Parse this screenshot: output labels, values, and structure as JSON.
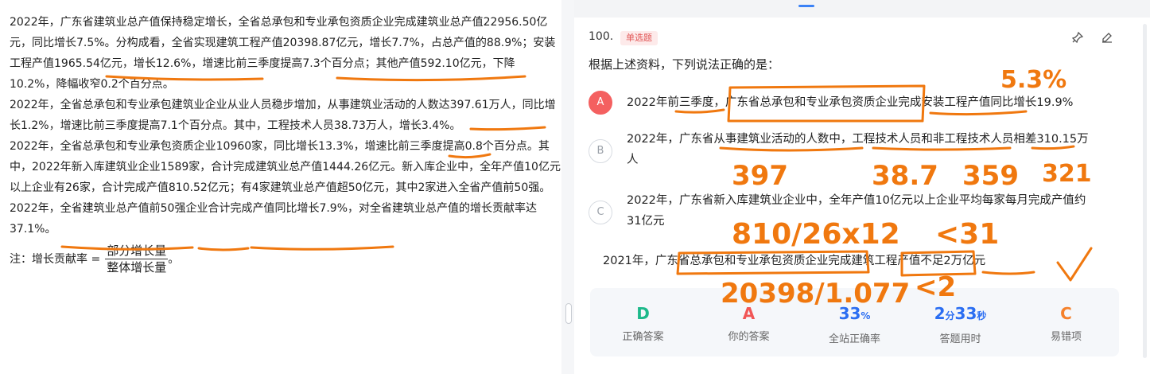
{
  "passage": {
    "p1": "2022年，广东省建筑业总产值保持稳定增长，全省总承包和专业承包资质企业完成建筑业总产值22956.50亿元，同比增长7.5%。分构成看，全省实现建筑工程产值20398.87亿元，增长7.7%，占总产值的88.9%；安装工程产值1965.54亿元，增长12.6%，增速比前三季度提高7.3个百分点；其他产值592.10亿元，下降10.2%，降幅收窄0.2个百分点。",
    "p2": "2022年，全省总承包和专业承包建筑业企业从业人员稳步增加，从事建筑业活动的人数达397.61万人，同比增长1.2%，增速比前三季度提高7.1个百分点。其中，工程技术人员38.73万人，增长3.4%。",
    "p3": "2022年，全省总承包和专业承包资质企业10960家，同比增长13.3%，增速比前三季度提高0.8个百分点。其中，2022年新入库建筑业企业1589家，合计完成建筑业总产值1444.26亿元。新入库企业中，全年产值10亿元以上企业有26家，合计完成产值810.52亿元；有4家建筑业总产值超50亿元，其中2家进入全省产值前50强。2022年，全省建筑业总产值前50强企业合计完成产值同比增长7.9%，对全省建筑业总产值的增长贡献率达37.1%。",
    "note_prefix": "注：增长贡献率 =",
    "note_numerator": "部分增长量",
    "note_denominator": "整体增长量",
    "note_suffix": "。"
  },
  "question": {
    "number": "100.",
    "type_badge": "单选题",
    "stem": "根据上述资料，下列说法正确的是：",
    "options": [
      {
        "letter": "A",
        "text": "2022年前三季度，广东省总承包和专业承包资质企业完成安装工程产值同比增长19.9%",
        "state": "wrong"
      },
      {
        "letter": "B",
        "text": "2022年，广东省从事建筑业活动的人数中，工程技术人员和非工程技术人员相差310.15万人",
        "state": "normal"
      },
      {
        "letter": "C",
        "text": "2022年，广东省新入库建筑业企业中，全年产值10亿元以上企业平均每家每月完成产值约31亿元",
        "state": "normal"
      },
      {
        "letter": "D",
        "text": "2021年，广东省总承包和专业承包资质企业完成建筑工程产值不足2万亿元",
        "state": "right"
      }
    ]
  },
  "stats": [
    {
      "value": "D",
      "unit": "",
      "label": "正确答案",
      "color": "#1db98a"
    },
    {
      "value": "A",
      "unit": "",
      "label": "你的答案",
      "color": "#f15656"
    },
    {
      "value": "33",
      "unit": "%",
      "label": "全站正确率",
      "color": "#2b6ef2"
    },
    {
      "value": "2",
      "unit": "分",
      "value2": "33",
      "unit2": "秒",
      "label": "答题用时",
      "color": "#2b6ef2"
    },
    {
      "value": "C",
      "unit": "",
      "label": "易错项",
      "color": "#f5812b"
    }
  ],
  "handwriting": {
    "a_note": "5.3%",
    "b_397": "397",
    "b_387": "38.7",
    "b_359": "359",
    "b_321": "321",
    "c_calc": "810/26x12",
    "c_cmp": "<31",
    "d_calc": "20398/1.077",
    "d_cmp": "<2"
  },
  "colors": {
    "ink": "#f0780f",
    "wrong": "#f46060",
    "right": "#3bbf9a",
    "badge": "#e15656"
  }
}
